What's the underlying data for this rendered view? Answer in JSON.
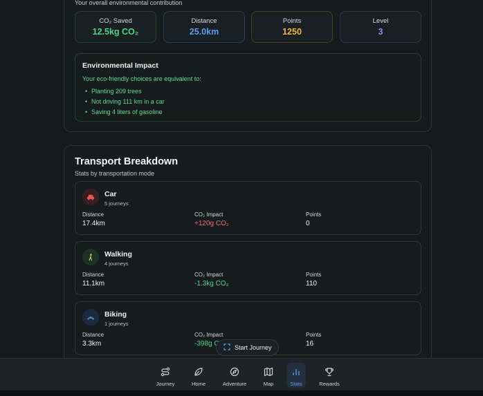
{
  "overview": {
    "subtitle": "Your overall environmental contribution",
    "stats": [
      {
        "label": "CO₂ Saved",
        "value": "12.5kg CO₂"
      },
      {
        "label": "Distance",
        "value": "25.0km"
      },
      {
        "label": "Points",
        "value": "1250"
      },
      {
        "label": "Level",
        "value": "3"
      }
    ],
    "impact": {
      "title": "Environmental Impact",
      "intro": "Your eco-friendly choices are equivalent to:",
      "items": [
        "Planting 209 trees",
        "Not driving 111 km in a car",
        "Saving 4 liters of gasoline"
      ]
    }
  },
  "transport": {
    "title": "Transport Breakdown",
    "subtitle": "Stats by transportation mode",
    "labels": {
      "distance": "Distance",
      "impact": "CO₂ Impact",
      "points": "Points"
    },
    "modes": [
      {
        "name": "Car",
        "journeys": "5 journeys",
        "distance": "17.4km",
        "impact": "+120g CO₂",
        "points": "0",
        "icon": "car-icon"
      },
      {
        "name": "Walking",
        "journeys": "4 journeys",
        "distance": "11.1km",
        "impact": "-1.3kg CO₂",
        "points": "110",
        "icon": "walking-icon"
      },
      {
        "name": "Biking",
        "journeys": "1 journeys",
        "distance": "3.3km",
        "impact": "-398g C",
        "points": "16",
        "icon": "bike-icon"
      }
    ]
  },
  "start_journey": {
    "label": "Start Journey"
  },
  "nav": {
    "items": [
      {
        "label": "Journey",
        "icon": "route-icon"
      },
      {
        "label": "Home",
        "icon": "leaf-icon"
      },
      {
        "label": "Adventure",
        "icon": "compass-icon"
      },
      {
        "label": "Map",
        "icon": "map-icon"
      },
      {
        "label": "Stats",
        "icon": "bar-chart-icon",
        "active": true
      },
      {
        "label": "Rewards",
        "icon": "trophy-icon"
      }
    ]
  },
  "colors": {
    "background": "#14191c",
    "co2": "#4fd488",
    "distance": "#5d9cf0",
    "points": "#f2b43c",
    "level": "#b478f2",
    "negative": "#ef6b6b"
  }
}
